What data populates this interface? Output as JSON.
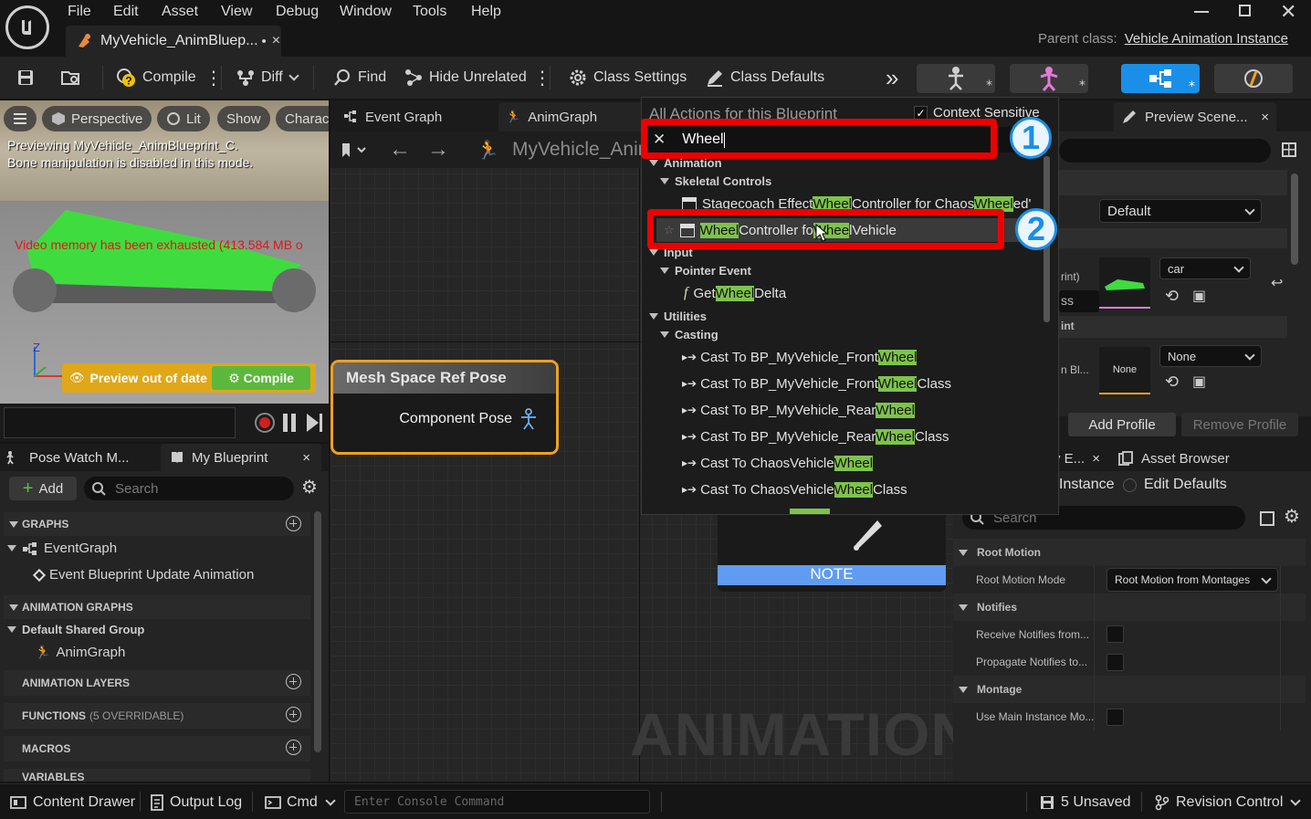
{
  "menu": {
    "file": "File",
    "edit": "Edit",
    "asset": "Asset",
    "view": "View",
    "debug": "Debug",
    "window": "Window",
    "tools": "Tools",
    "help": "Help"
  },
  "tab": {
    "title": "MyVehicle_AnimBluep...",
    "modified": "•",
    "close": "×"
  },
  "parent_class": {
    "label": "Parent class:",
    "value": "Vehicle Animation Instance"
  },
  "toolbar": {
    "compile": "Compile",
    "diff": "Diff",
    "find": "Find",
    "hide_unrelated": "Hide Unrelated",
    "class_settings": "Class Settings",
    "class_defaults": "Class Defaults",
    "more": "»"
  },
  "viewport": {
    "perspective": "Perspective",
    "lit": "Lit",
    "show": "Show",
    "character": "Charac",
    "preview_line1": "Previewing MyVehicle_AnimBlueprint_C.",
    "preview_line2": "Bone manipulation is disabled in this mode.",
    "memory_warning": "Video memory has been exhausted (413.584 MB o",
    "axis_z": "Z",
    "preview_out_of_date": "Preview out of date",
    "compile": "Compile"
  },
  "left": {
    "pose_watch": "Pose Watch M...",
    "my_blueprint": "My Blueprint",
    "close": "×",
    "add": "Add",
    "search_placeholder": "Search",
    "graphs": "GRAPHS",
    "event_graph": "EventGraph",
    "event_update": "Event Blueprint Update Animation",
    "anim_graphs": "ANIMATION GRAPHS",
    "shared_group": "Default Shared Group",
    "anim_graph": "AnimGraph",
    "anim_layers": "ANIMATION LAYERS",
    "functions": "FUNCTIONS",
    "functions_note": "(5 OVERRIDABLE)",
    "macros": "MACROS",
    "variables": "VARIABLES"
  },
  "graph": {
    "tab_event": "Event Graph",
    "tab_anim": "AnimGraph",
    "breadcrumb": "MyVehicle_Anim",
    "node_title": "Mesh Space Ref Pose",
    "node_pin": "Component Pose",
    "note": "NOTE",
    "watermark": "ANIMATION"
  },
  "popup": {
    "header": "All Actions for this Blueprint",
    "context_sensitive": "Context Sensitive",
    "search_value": "Wheel",
    "cat_animation": "Animation",
    "cat_skeletal": "Skeletal Controls",
    "item1": {
      "a": "Stagecoach Effect ",
      "h1": "Wheel",
      "b": " Controller for Chaos",
      "h2": "Wheel",
      "c": "ed'"
    },
    "item2": {
      "h1": "Wheel",
      "b": " Controller fo",
      "h2": "Whee",
      "c": "lVehicle"
    },
    "cat_input": "Input",
    "cat_pointer": "Pointer Event",
    "item3": {
      "a": "Get ",
      "h1": "Wheel",
      "b": " Delta"
    },
    "cat_utilities": "Utilities",
    "cat_casting": "Casting",
    "casts": [
      {
        "a": "Cast To BP_MyVehicle_Front",
        "h": "Wheel",
        "b": ""
      },
      {
        "a": "Cast To BP_MyVehicle_Front",
        "h": "Wheel",
        "b": " Class"
      },
      {
        "a": "Cast To BP_MyVehicle_Rear",
        "h": "Wheel",
        "b": ""
      },
      {
        "a": "Cast To BP_MyVehicle_Rear",
        "h": "Wheel",
        "b": " Class"
      },
      {
        "a": "Cast To ChaosVehicle",
        "h": "Wheel",
        "b": ""
      },
      {
        "a": "Cast To ChaosVehicle",
        "h": "Wheel",
        "b": " Class"
      }
    ],
    "annot1": "1",
    "annot2": "2"
  },
  "right": {
    "preview_scene": "Preview Scene...",
    "close": "×",
    "default": "Default",
    "car": "car",
    "rint": "rint)",
    "ss": "ss",
    "int": "int",
    "nbl": "n Bl...",
    "none_thumb": "None",
    "none": "None",
    "add_profile": "Add Profile",
    "remove_profile": "Remove Profile",
    "tab_details": "y E...",
    "asset_browser": "Asset Browser",
    "instance": "Instance",
    "edit_defaults": "Edit Defaults",
    "search_placeholder": "Search",
    "root_motion": "Root Motion",
    "root_motion_mode": "Root Motion Mode",
    "root_motion_value": "Root Motion from Montages",
    "notifies": "Notifies",
    "receive_notifies": "Receive Notifies from...",
    "propagate_notifies": "Propagate Notifies to...",
    "montage": "Montage",
    "use_main_instance": "Use Main Instance Mo..."
  },
  "status": {
    "content_drawer": "Content Drawer",
    "output_log": "Output Log",
    "cmd": "Cmd",
    "console_placeholder": "Enter Console Command",
    "unsaved": "5 Unsaved",
    "revision_control": "Revision Control"
  },
  "colors": {
    "accent_blue": "#1a8fe8",
    "highlight_green": "#7ec34b",
    "annotation_red": "#ee0000",
    "node_orange": "#f0a020",
    "note_blue": "#5f9cf2"
  }
}
